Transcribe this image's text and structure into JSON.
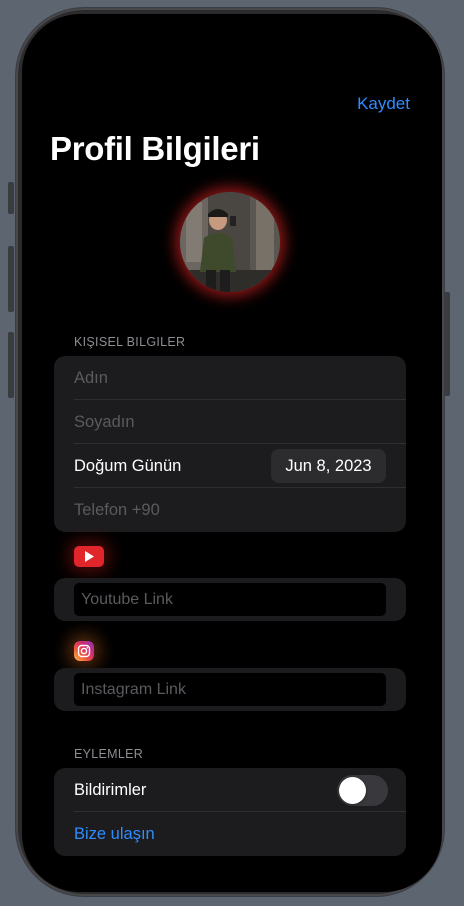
{
  "header": {
    "save_label": "Kaydet",
    "title": "Profil Bilgileri"
  },
  "avatar": {
    "glow_color": "#ff2828"
  },
  "personal": {
    "section_label": "KIŞISEL BILGILER",
    "first_name_placeholder": "Adın",
    "last_name_placeholder": "Soyadın",
    "birthday_label": "Doğum Günün",
    "birthday_value": "Jun 8, 2023",
    "phone_placeholder": "Telefon +90"
  },
  "social": {
    "youtube_icon": "youtube-icon",
    "youtube_placeholder": "Youtube Link",
    "instagram_icon": "instagram-icon",
    "instagram_placeholder": "Instagram Link"
  },
  "actions": {
    "section_label": "EYLEMLER",
    "notifications_label": "Bildirimler",
    "notifications_on": false,
    "contact_label": "Bize ulaşın"
  },
  "colors": {
    "accent": "#2f8cff",
    "background": "#000000",
    "card": "#1c1c1e"
  }
}
